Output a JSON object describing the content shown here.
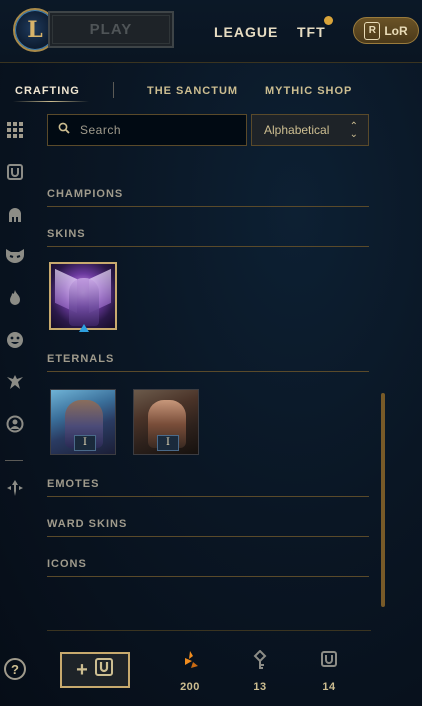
{
  "topbar": {
    "logo": "L",
    "play_label": "PLAY",
    "nav": [
      "LEAGUE",
      "TFT"
    ],
    "lor_label": "LoR",
    "lor_icon_text": "R"
  },
  "subnav": {
    "tabs": [
      "CRAFTING",
      "THE SANCTUM",
      "MYTHIC SHOP"
    ],
    "active_tab": "CRAFTING"
  },
  "sidebar": {
    "icons": [
      "grid-icon",
      "chest-icon",
      "helmet-icon",
      "mask-icon",
      "flame-icon",
      "emote-icon",
      "ward-icon",
      "profile-icon",
      "arrows-icon"
    ]
  },
  "filters": {
    "search_placeholder": "Search",
    "sort_value": "Alphabetical"
  },
  "sections": {
    "champions": "CHAMPIONS",
    "skins": "SKINS",
    "eternals": "ETERNALS",
    "emotes": "EMOTES",
    "ward_skins": "WARD SKINS",
    "icons": "ICONS"
  },
  "eternals": {
    "items": [
      {
        "badge": "I"
      },
      {
        "badge": "I"
      }
    ]
  },
  "footer": {
    "help": "?",
    "craft_plus": "+",
    "currencies": [
      {
        "icon": "orange-essence-icon",
        "value": "200"
      },
      {
        "icon": "key-fragment-icon",
        "value": "13"
      },
      {
        "icon": "chest-icon",
        "value": "14"
      }
    ]
  },
  "colors": {
    "gold": "#c8aa6e",
    "text_gold": "#cdbe91",
    "accent_blue": "#2ea0e0",
    "orange_essence": "#f08c1e"
  }
}
